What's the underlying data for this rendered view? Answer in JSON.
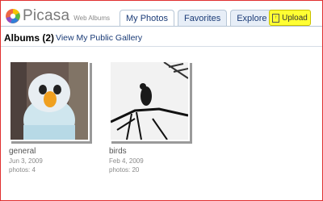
{
  "app": {
    "logo_text": "Picasa",
    "logo_sub": "Web Albums"
  },
  "tabs": [
    {
      "label": "My Photos"
    },
    {
      "label": "Favorites"
    },
    {
      "label": "Explore"
    }
  ],
  "upload": {
    "label": "Upload"
  },
  "albums": {
    "title": "Albums (2)",
    "public_link": "View My Public Gallery",
    "items": [
      {
        "title": "general",
        "date": "Jun 3, 2009",
        "count": "photos: 4"
      },
      {
        "title": "birds",
        "date": "Feb 4, 2009",
        "count": "photos: 20"
      }
    ]
  }
}
